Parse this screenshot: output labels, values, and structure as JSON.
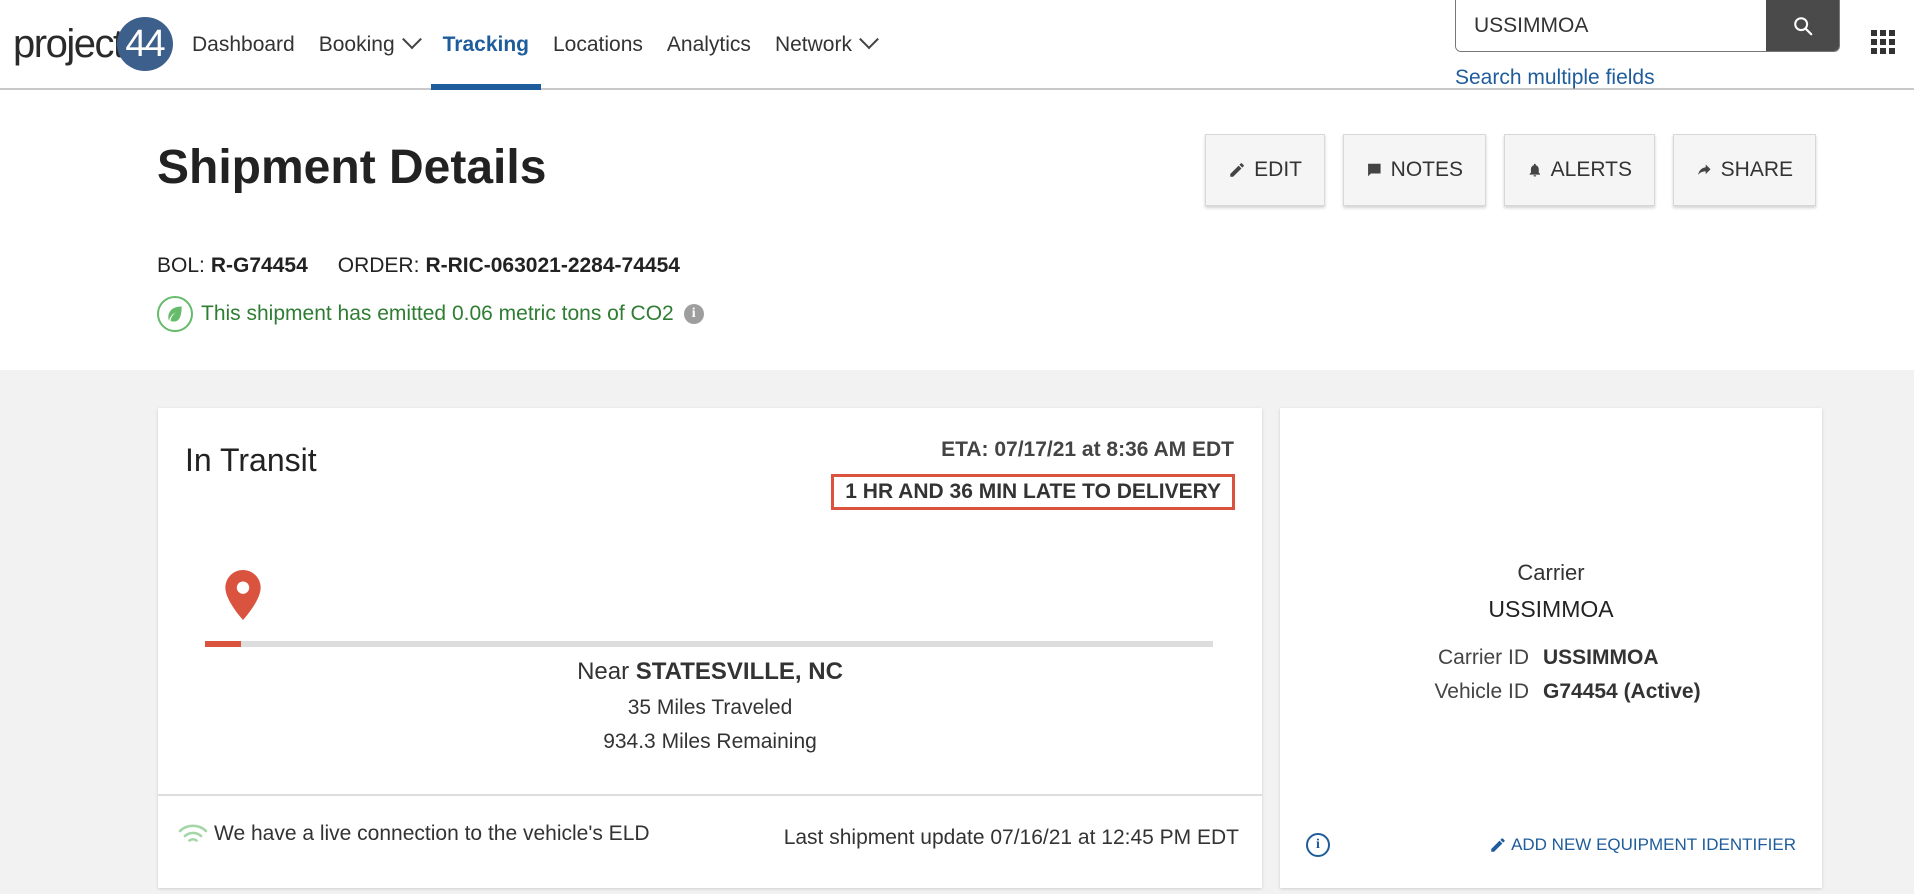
{
  "brand": {
    "logo_text": "project",
    "logo_number": "44"
  },
  "nav": {
    "items": [
      {
        "label": "Dashboard"
      },
      {
        "label": "Booking"
      },
      {
        "label": "Tracking"
      },
      {
        "label": "Locations"
      },
      {
        "label": "Analytics"
      },
      {
        "label": "Network"
      }
    ],
    "active": "Tracking"
  },
  "search": {
    "value": "USSIMMOA",
    "multi_link": "Search multiple fields"
  },
  "page": {
    "title": "Shipment Details",
    "actions": {
      "edit": "EDIT",
      "notes": "NOTES",
      "alerts": "ALERTS",
      "share": "SHARE"
    },
    "bol_label": "BOL:",
    "bol_value": "R-G74454",
    "order_label": "ORDER:",
    "order_value": "R-RIC-063021-2284-74454",
    "co2_text": "This shipment has emitted 0.06 metric tons of CO2"
  },
  "status": {
    "title": "In Transit",
    "eta": "ETA: 07/17/21 at 8:36 AM EDT",
    "late_badge": "1 HR AND 36 MIN LATE TO DELIVERY",
    "progress_fraction": 0.036,
    "near_label": "Near",
    "near_location": "STATESVILLE, NC",
    "miles_traveled": "35 Miles Traveled",
    "miles_remaining": "934.3 Miles Remaining",
    "eld_text": "We have a live connection to the vehicle's ELD",
    "last_update": "Last shipment update 07/16/21 at 12:45 PM EDT"
  },
  "carrier": {
    "label": "Carrier",
    "name": "USSIMMOA",
    "carrier_id_label": "Carrier ID",
    "carrier_id_value": "USSIMMOA",
    "vehicle_id_label": "Vehicle ID",
    "vehicle_id_value": "G74454 (Active)",
    "add_equipment": "ADD NEW EQUIPMENT IDENTIFIER"
  },
  "colors": {
    "brand_blue": "#1e5c9b",
    "late_red": "#d9533f",
    "co2_green": "#2e7d32"
  },
  "icons": [
    "search-icon",
    "chevron-down-icon",
    "apps-grid-icon",
    "pencil-icon",
    "comment-icon",
    "bell-icon",
    "share-arrow-icon",
    "leaf-icon",
    "info-icon",
    "map-pin-icon",
    "wifi-icon"
  ]
}
